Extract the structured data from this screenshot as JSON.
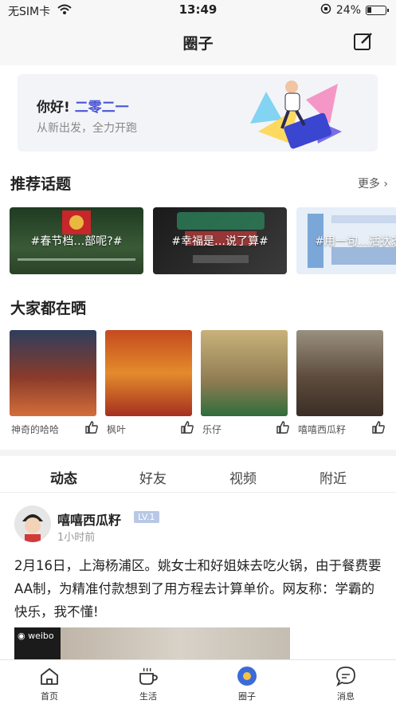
{
  "status_bar": {
    "carrier": "无SIM卡",
    "time": "13:49",
    "battery": "24%"
  },
  "nav": {
    "title": "圈子"
  },
  "banner": {
    "greeting": "你好!",
    "greeting_accent": "二零二一",
    "subtitle": "从新出发，全力开跑"
  },
  "topics": {
    "title": "推荐话题",
    "more": "更多",
    "items": [
      {
        "label": "#春节档…部呢?#"
      },
      {
        "label": "#幸福是…说了算#"
      },
      {
        "label": "#用一句…活状态#"
      }
    ]
  },
  "shows": {
    "title": "大家都在晒",
    "items": [
      {
        "user": "神奇的哈哈"
      },
      {
        "user": "枫叶"
      },
      {
        "user": "乐仔"
      },
      {
        "user": "嘻嘻西瓜籽"
      }
    ]
  },
  "feed_tabs": [
    "动态",
    "好友",
    "视频",
    "附近"
  ],
  "post": {
    "username": "嘻嘻西瓜籽",
    "level": "LV.1",
    "time": "1小时前",
    "text": "2月16日，上海杨浦区。姚女士和好姐妹去吃火锅，由于餐费要AA制，为精准付款想到了用方程去计算单价。网友称：学霸的快乐，我不懂!",
    "image_badge": "weibo"
  },
  "tabbar": [
    "首页",
    "生活",
    "圈子",
    "消息"
  ],
  "colors": {
    "accent": "#4a55d8",
    "active_tab": "#3a6bd8",
    "level_badge": "#b8c8e6"
  }
}
